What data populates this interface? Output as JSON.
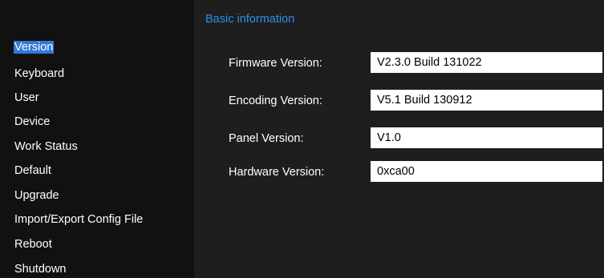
{
  "sidebar": {
    "items": [
      {
        "label": "Version",
        "active": true
      },
      {
        "label": "Keyboard"
      },
      {
        "label": "User"
      },
      {
        "label": "Device"
      },
      {
        "label": "Work Status"
      },
      {
        "label": "Default"
      },
      {
        "label": "Upgrade"
      },
      {
        "label": "Import/Export Config File"
      },
      {
        "label": "Reboot"
      },
      {
        "label": "Shutdown"
      }
    ]
  },
  "main": {
    "section_title": "Basic information",
    "fields": [
      {
        "label": "Firmware Version:",
        "value": "V2.3.0 Build 131022"
      },
      {
        "label": "Encoding Version:",
        "value": "V5.1 Build 130912"
      },
      {
        "label": "Panel Version:",
        "value": "V1.0"
      },
      {
        "label": "Hardware Version:",
        "value": "0xca00"
      }
    ]
  },
  "colors": {
    "accent": "#2e8fe8",
    "selection": "#3179d6",
    "sidebar_bg": "#111111",
    "main_bg": "#1e1e1e"
  }
}
